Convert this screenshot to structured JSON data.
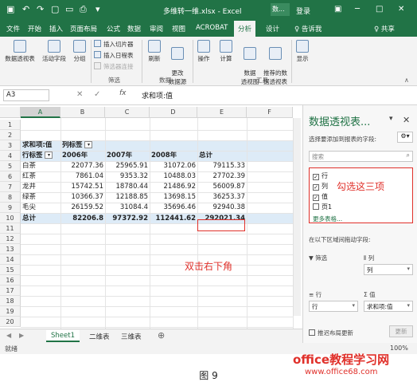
{
  "titlebar": {
    "title": "多维转一维.xlsx - Excel",
    "search_label": "数...",
    "login": "登录"
  },
  "tabs": [
    "文件",
    "开始",
    "插入",
    "页面布局",
    "公式",
    "数据",
    "审阅",
    "视图",
    "ACROBAT",
    "分析",
    "设计",
    "♀ 告诉我",
    "♀ 共享"
  ],
  "active_tab": "分析",
  "ribbon": {
    "pivot_table": "数据透视表",
    "active_field": "活动字段",
    "group": "分组",
    "insert_slicer": "插入切片器",
    "insert_timeline": "插入日程表",
    "filter_connections": "筛选器连接",
    "filter_group": "筛选",
    "refresh": "刷新",
    "change_source": "更改\n数据源",
    "data_group": "数据",
    "actions": "操作",
    "calculations": "计算",
    "pivot_chart": "数据\n透视图",
    "recommended": "推荐的数\n据透视表",
    "tools_group": "工具",
    "show": "显示"
  },
  "formula_bar": {
    "name_box": "A3",
    "fx": "fx",
    "value": "求和项:值"
  },
  "columns": [
    "A",
    "B",
    "C",
    "D",
    "E",
    "F"
  ],
  "rows": [
    "1",
    "2",
    "3",
    "4",
    "5",
    "6",
    "7",
    "8",
    "9",
    "10",
    "11",
    "12",
    "13",
    "14",
    "15",
    "16",
    "17",
    "18",
    "19",
    "20"
  ],
  "pivot": {
    "sum_label": "求和项:值",
    "col_label": "列标签",
    "row_label": "行标签",
    "years": [
      "2006年",
      "2007年",
      "2008年",
      "总计"
    ],
    "data": [
      [
        "白茶",
        "22077.36",
        "25965.91",
        "31072.06",
        "79115.33"
      ],
      [
        "红茶",
        "7861.04",
        "9353.32",
        "10488.03",
        "27702.39"
      ],
      [
        "龙井",
        "15742.51",
        "18780.44",
        "21486.92",
        "56009.87"
      ],
      [
        "绿茶",
        "10366.37",
        "12188.85",
        "13698.15",
        "36253.37"
      ],
      [
        "毛尖",
        "26159.52",
        "31084.4",
        "35696.46",
        "92940.38"
      ]
    ],
    "total": [
      "总计",
      "82206.8",
      "97372.92",
      "112441.62",
      "292021.34"
    ]
  },
  "annotation_double_click": "双击右下角",
  "sheets": [
    "Sheet1",
    "二维表",
    "三维表"
  ],
  "active_sheet": "Sheet1",
  "status": "就绪",
  "zoom": "100%",
  "pane": {
    "title": "数据透视表...",
    "subtitle": "选择要添加到报表的字段:",
    "search_placeholder": "搜索",
    "fields": [
      {
        "label": "行",
        "checked": true
      },
      {
        "label": "列",
        "checked": true
      },
      {
        "label": "值",
        "checked": true
      },
      {
        "label": "页1",
        "checked": false
      }
    ],
    "annotation": "勾选这三项",
    "more_tables": "更多表格...",
    "drag_hint": "在以下区域间拖动字段:",
    "filter_label": "筛选",
    "columns_label": "列",
    "columns_value": "列",
    "rows_label": "行",
    "rows_value": "行",
    "values_label": "Σ 值",
    "values_value": "求和项:值",
    "defer": "推迟布局更新",
    "update": "更新"
  },
  "caption": "图 9",
  "watermark": {
    "line1": "office教程学习网",
    "line2": "www.office68.com"
  }
}
